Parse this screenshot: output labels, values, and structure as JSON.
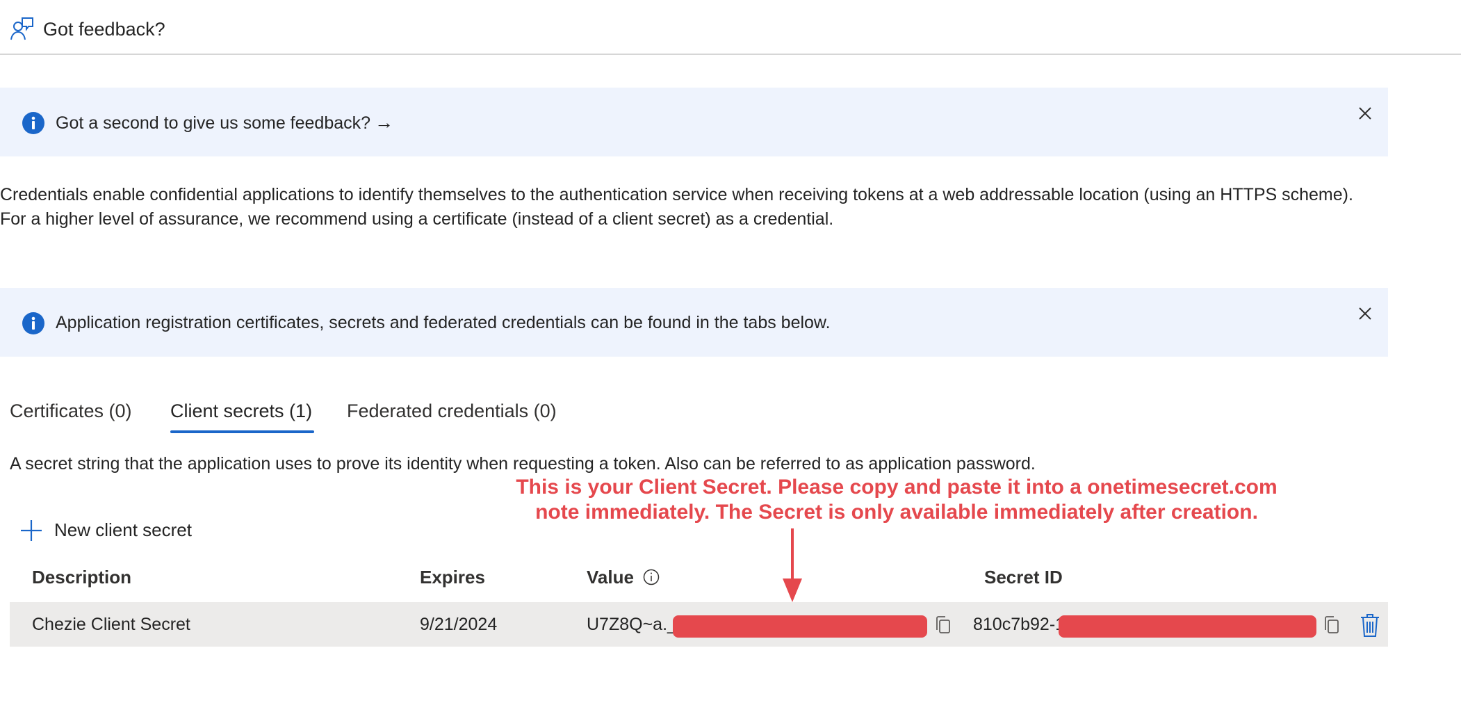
{
  "header": {
    "feedback_label": "Got feedback?"
  },
  "feedback_banner": {
    "text": "Got a second to give us some feedback?",
    "arrow": "→"
  },
  "description": "Credentials enable confidential applications to identify themselves to the authentication service when receiving tokens at a web addressable location (using an HTTPS scheme). For a higher level of assurance, we recommend using a certificate (instead of a client secret) as a credential.",
  "info_banner": {
    "text": "Application registration certificates, secrets and federated credentials can be found in the tabs below."
  },
  "tabs": [
    {
      "label": "Certificates (0)",
      "active": false
    },
    {
      "label": "Client secrets (1)",
      "active": true
    },
    {
      "label": "Federated credentials (0)",
      "active": false
    }
  ],
  "tab_description": "A secret string that the application uses to prove its identity when requesting a token. Also can be referred to as application password.",
  "annotation": {
    "line1": "This is your Client Secret. Please copy and paste it into a onetimesecret.com",
    "line2": "note immediately. The Secret is only available immediately after creation."
  },
  "new_secret_label": "New client secret",
  "table": {
    "headers": {
      "description": "Description",
      "expires": "Expires",
      "value": "Value",
      "secret_id": "Secret ID"
    },
    "rows": [
      {
        "description": "Chezie Client Secret",
        "expires": "9/21/2024",
        "value_prefix": "U7Z8Q~a._",
        "secret_id_prefix": "810c7b92-1"
      }
    ]
  },
  "colors": {
    "accent": "#1a66c9",
    "banner_bg": "#eef3fd",
    "redaction": "#e5484d",
    "row_bg": "#ecebea"
  },
  "icons": [
    "feedback-person-icon",
    "info-icon",
    "close-icon",
    "arrow-right-icon",
    "plus-icon",
    "copy-icon",
    "trash-icon"
  ]
}
